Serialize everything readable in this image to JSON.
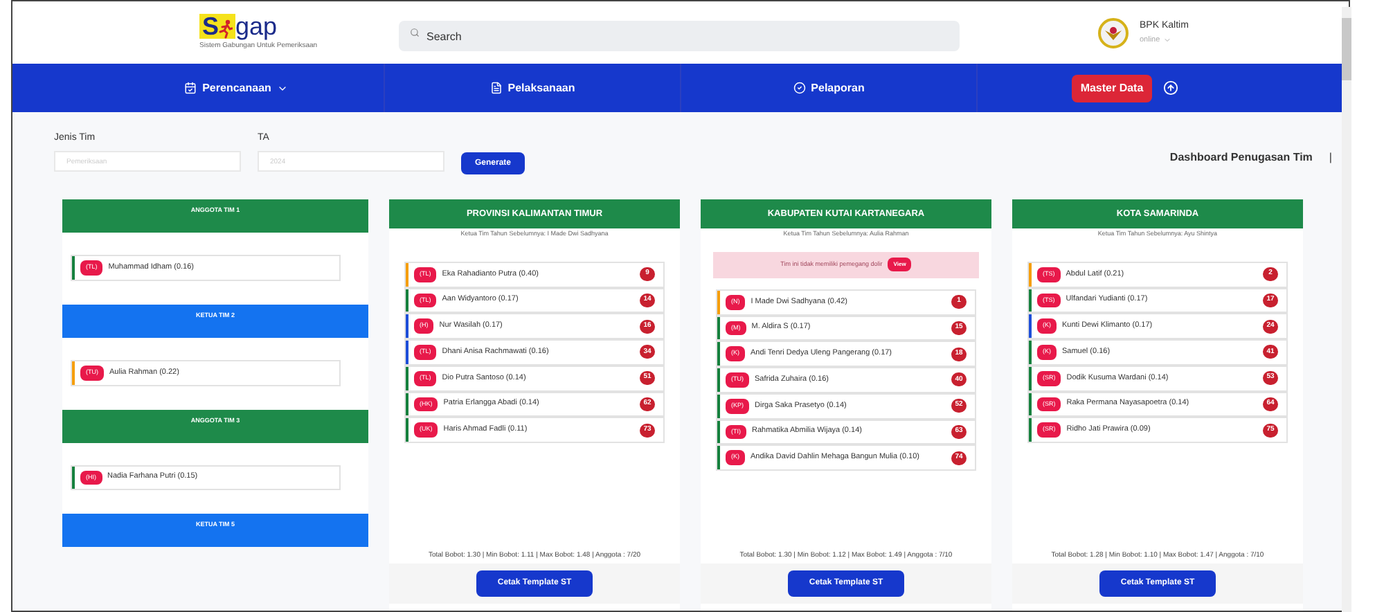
{
  "header": {
    "logo": {
      "prefix": "S",
      "suffix": "gap"
    },
    "tagline": "Sistem Gabungan Untuk Pemeriksaan",
    "search": {
      "placeholder": "Search"
    },
    "user": {
      "name": "BPK Kaltim",
      "status": "online"
    }
  },
  "nav": [
    {
      "kind": "dropdown",
      "label": "Perencanaan"
    },
    {
      "kind": "link",
      "label": "Pelaksanaan"
    },
    {
      "kind": "link",
      "label": "Pelaporan"
    },
    {
      "kind": "button",
      "label": "Master Data"
    }
  ],
  "form": {
    "fields": [
      {
        "label": "Jenis Tim",
        "placeholder": "Pemeriksaan"
      },
      {
        "label": "TA",
        "placeholder": "2024"
      }
    ],
    "button": "Generate",
    "title": "Dashboard Penugasan Tim",
    "separator": "|"
  },
  "teams": [
    {
      "kind": "anggota",
      "title": "ANGGOTA TIM 1",
      "members": [
        {
          "badge": "(TL)",
          "name": "Muhammad Idham (0.16)",
          "color": "#15803d"
        }
      ]
    },
    {
      "kind": "ketua",
      "title": "KETUA TIM 2",
      "members": [
        {
          "badge": "(TU)",
          "name": "Aulia Rahman (0.22)",
          "color": "#f59e0b"
        }
      ]
    },
    {
      "kind": "anggota",
      "title": "ANGGOTA TIM 3",
      "members": [
        {
          "badge": "(HI)",
          "name": "Nadia Farhana Putri (0.15)",
          "color": "#15803d"
        }
      ]
    },
    {
      "kind": "ketua",
      "title": "KETUA TIM 5"
    }
  ],
  "cards": [
    {
      "title": "PROVINSI KALIMANTAN TIMUR",
      "subtitle": "Ketua Tim Tahun Sebelumnya: I Made Dwi Sadhyana",
      "members": [
        {
          "badge": "(TL)",
          "name": "Eka Rahadianto Putra (0.40)",
          "number": "9",
          "color": "#f59e0b"
        },
        {
          "badge": "(TL)",
          "name": "Aan Widyantoro (0.17)",
          "number": "14",
          "color": "#15803d"
        },
        {
          "badge": "(H)",
          "name": "Nur Wasilah (0.17)",
          "number": "16",
          "color": "#1d4ed8"
        },
        {
          "badge": "(TL)",
          "name": "Dhani Anisa Rachmawati (0.16)",
          "number": "34",
          "color": "#1d4ed8"
        },
        {
          "badge": "(TL)",
          "name": "Dio Putra Santoso (0.14)",
          "number": "51",
          "color": "#15803d"
        },
        {
          "badge": "(HK)",
          "name": "Patria Erlangga Abadi (0.14)",
          "number": "62",
          "color": "#15803d"
        },
        {
          "badge": "(UK)",
          "name": "Haris Ahmad Fadli (0.11)",
          "number": "73",
          "color": "#15803d"
        }
      ],
      "stats": "Total Bobot: 1.30 | Min Bobot: 1.11 | Max Bobot: 1.48 | Anggota : 7/20",
      "button": "Cetak Template ST"
    },
    {
      "title": "KABUPATEN KUTAI KARTANEGARA",
      "subtitle": "Ketua Tim Tahun Sebelumnya: Aulia Rahman",
      "alert": {
        "text": "Tim ini tidak memiliki pemegang dolir",
        "button": "View"
      },
      "members": [
        {
          "badge": "(N)",
          "name": "I Made Dwi Sadhyana (0.42)",
          "number": "1",
          "color": "#f59e0b"
        },
        {
          "badge": "(M)",
          "name": "M. Aldira S (0.17)",
          "number": "15",
          "color": "#15803d"
        },
        {
          "badge": "(K)",
          "name": "Andi Tenri Dedya Uleng Pangerang (0.17)",
          "number": "18",
          "color": "#15803d"
        },
        {
          "badge": "(TU)",
          "name": "Safrida Zuhaira (0.16)",
          "number": "40",
          "color": "#15803d"
        },
        {
          "badge": "(KP)",
          "name": "Dirga Saka Prasetyo (0.14)",
          "number": "52",
          "color": "#15803d"
        },
        {
          "badge": "(TI)",
          "name": "Rahmatika Abmilia Wijaya (0.14)",
          "number": "63",
          "color": "#15803d"
        },
        {
          "badge": "(K)",
          "name": "Andika David Dahlin Mehaga Bangun Mulia (0.10)",
          "number": "74",
          "color": "#15803d"
        }
      ],
      "stats": "Total Bobot: 1.30 | Min Bobot: 1.12 | Max Bobot: 1.49 | Anggota : 7/10",
      "button": "Cetak Template ST"
    },
    {
      "title": "KOTA SAMARINDA",
      "subtitle": "Ketua Tim Tahun Sebelumnya: Ayu Shintya",
      "members": [
        {
          "badge": "(TS)",
          "name": "Abdul Latif (0.21)",
          "number": "2",
          "color": "#f59e0b"
        },
        {
          "badge": "(TS)",
          "name": "Ulfandari Yudianti (0.17)",
          "number": "17",
          "color": "#15803d"
        },
        {
          "badge": "(K)",
          "name": "Kunti Dewi Klimanto (0.17)",
          "number": "24",
          "color": "#1d4ed8"
        },
        {
          "badge": "(K)",
          "name": "Samuel (0.16)",
          "number": "41",
          "color": "#15803d"
        },
        {
          "badge": "(SR)",
          "name": "Dodik Kusuma Wardani (0.14)",
          "number": "53",
          "color": "#15803d"
        },
        {
          "badge": "(SR)",
          "name": "Raka Permana Nayasapoetra (0.14)",
          "number": "64",
          "color": "#15803d"
        },
        {
          "badge": "(SR)",
          "name": "Ridho Jati Prawira (0.09)",
          "number": "75",
          "color": "#15803d"
        }
      ],
      "stats": "Total Bobot: 1.28 | Min Bobot: 1.10 | Max Bobot: 1.47 | Anggota : 7/10",
      "button": "Cetak Template ST"
    }
  ]
}
